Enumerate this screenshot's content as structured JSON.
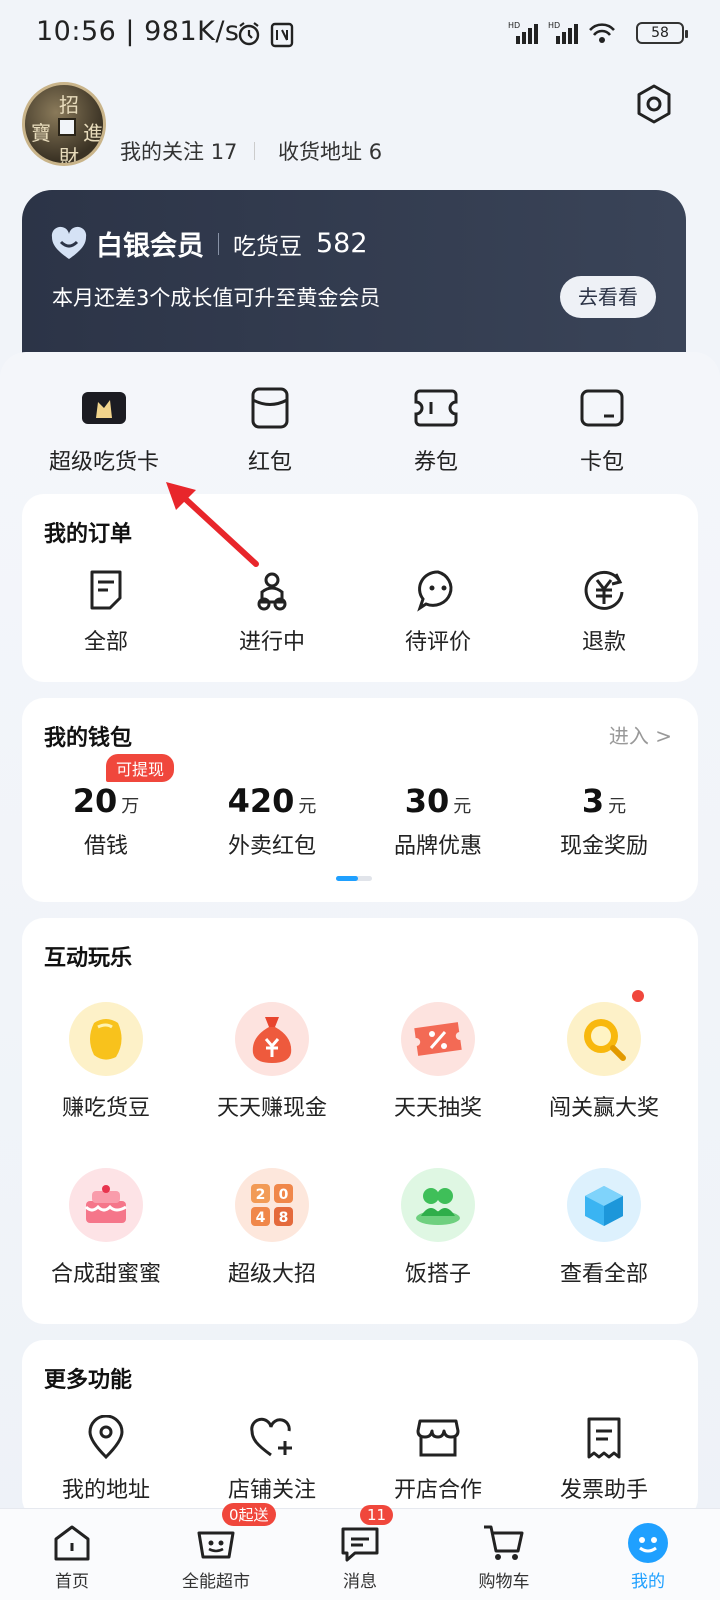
{
  "status_bar": {
    "time": "10:56",
    "speed": "| 981K/s",
    "battery": "58"
  },
  "profile": {
    "following_label": "我的关注",
    "following_count": "17",
    "address_label": "收货地址",
    "address_count": "6"
  },
  "member": {
    "level": "白银会员",
    "beans_label": "吃货豆",
    "beans_value": "582",
    "tip": "本月还差3个成长值可升至黄金会员",
    "button": "去看看"
  },
  "quick_links": [
    {
      "label": "超级吃货卡",
      "icon": "crown-card-icon"
    },
    {
      "label": "红包",
      "icon": "red-packet-icon"
    },
    {
      "label": "券包",
      "icon": "coupon-icon"
    },
    {
      "label": "卡包",
      "icon": "card-wallet-icon"
    }
  ],
  "orders": {
    "title": "我的订单",
    "items": [
      {
        "label": "全部",
        "icon": "document-icon"
      },
      {
        "label": "进行中",
        "icon": "scooter-icon"
      },
      {
        "label": "待评价",
        "icon": "comment-icon"
      },
      {
        "label": "退款",
        "icon": "refund-icon"
      }
    ]
  },
  "wallet": {
    "title": "我的钱包",
    "enter": "进入 >",
    "tag": "可提现",
    "items": [
      {
        "value": "20",
        "unit": "万",
        "label": "借钱"
      },
      {
        "value": "420",
        "unit": "元",
        "label": "外卖红包"
      },
      {
        "value": "30",
        "unit": "元",
        "label": "品牌优惠"
      },
      {
        "value": "3",
        "unit": "元",
        "label": "现金奖励"
      }
    ]
  },
  "fun": {
    "title": "互动玩乐",
    "items": [
      {
        "label": "赚吃货豆",
        "icon": "bean-icon"
      },
      {
        "label": "天天赚现金",
        "icon": "money-bag-icon"
      },
      {
        "label": "天天抽奖",
        "icon": "lottery-ticket-icon"
      },
      {
        "label": "闯关赢大奖",
        "icon": "magnifier-coin-icon"
      },
      {
        "label": "合成甜蜜蜜",
        "icon": "cake-icon"
      },
      {
        "label": "超级大招",
        "icon": "game-2048-icon"
      },
      {
        "label": "饭搭子",
        "icon": "friends-icon"
      },
      {
        "label": "查看全部",
        "icon": "cube-icon"
      }
    ],
    "tile_2048": [
      "2",
      "0",
      "4",
      "8"
    ]
  },
  "more": {
    "title": "更多功能",
    "items": [
      {
        "label": "我的地址",
        "icon": "location-icon"
      },
      {
        "label": "店铺关注",
        "icon": "heart-plus-icon"
      },
      {
        "label": "开店合作",
        "icon": "shop-icon"
      },
      {
        "label": "发票助手",
        "icon": "invoice-icon"
      }
    ]
  },
  "tabbar": {
    "items": [
      {
        "label": "首页",
        "icon": "home-icon"
      },
      {
        "label": "全能超市",
        "icon": "basket-icon",
        "badge": "0起送"
      },
      {
        "label": "消息",
        "icon": "message-icon",
        "badge": "11"
      },
      {
        "label": "购物车",
        "icon": "cart-icon"
      },
      {
        "label": "我的",
        "icon": "profile-icon"
      }
    ]
  },
  "colors": {
    "accent": "#1fa0ff",
    "red": "#f0473c",
    "member_bg": "#2c3447"
  }
}
